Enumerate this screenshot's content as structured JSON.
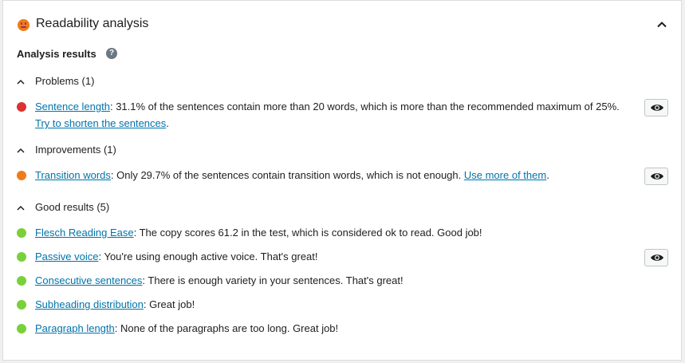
{
  "header": {
    "title": "Readability analysis",
    "score_icon": "smiley-face-icon",
    "score_color": "#ee7c1b"
  },
  "analysis": {
    "label": "Analysis results",
    "help": "?"
  },
  "colors": {
    "problem": "#dc3232",
    "improvement": "#ee7c1b",
    "good": "#7ad03a",
    "link": "#0073aa"
  },
  "groups": {
    "problems": {
      "label": "Problems (1)",
      "items": [
        {
          "link": "Sentence length",
          "text": ": 31.1% of the sentences contain more than 20 words, which is more than the recommended maximum of 25%. ",
          "action": "Try to shorten the sentences",
          "tail": "."
        }
      ]
    },
    "improvements": {
      "label": "Improvements (1)",
      "items": [
        {
          "link": "Transition words",
          "text": ": Only 29.7% of the sentences contain transition words, which is not enough. ",
          "action": "Use more of them",
          "tail": "."
        }
      ]
    },
    "good": {
      "label": "Good results (5)",
      "items": [
        {
          "link": "Flesch Reading Ease",
          "text": ": The copy scores 61.2 in the test, which is considered ok to read. Good job!"
        },
        {
          "link": "Passive voice",
          "text": ": You're using enough active voice. That's great!"
        },
        {
          "link": "Consecutive sentences",
          "text": ": There is enough variety in your sentences. That's great!"
        },
        {
          "link": "Subheading distribution",
          "text": ": Great job!"
        },
        {
          "link": "Paragraph length",
          "text": ": None of the paragraphs are too long. Great job!"
        }
      ]
    }
  }
}
